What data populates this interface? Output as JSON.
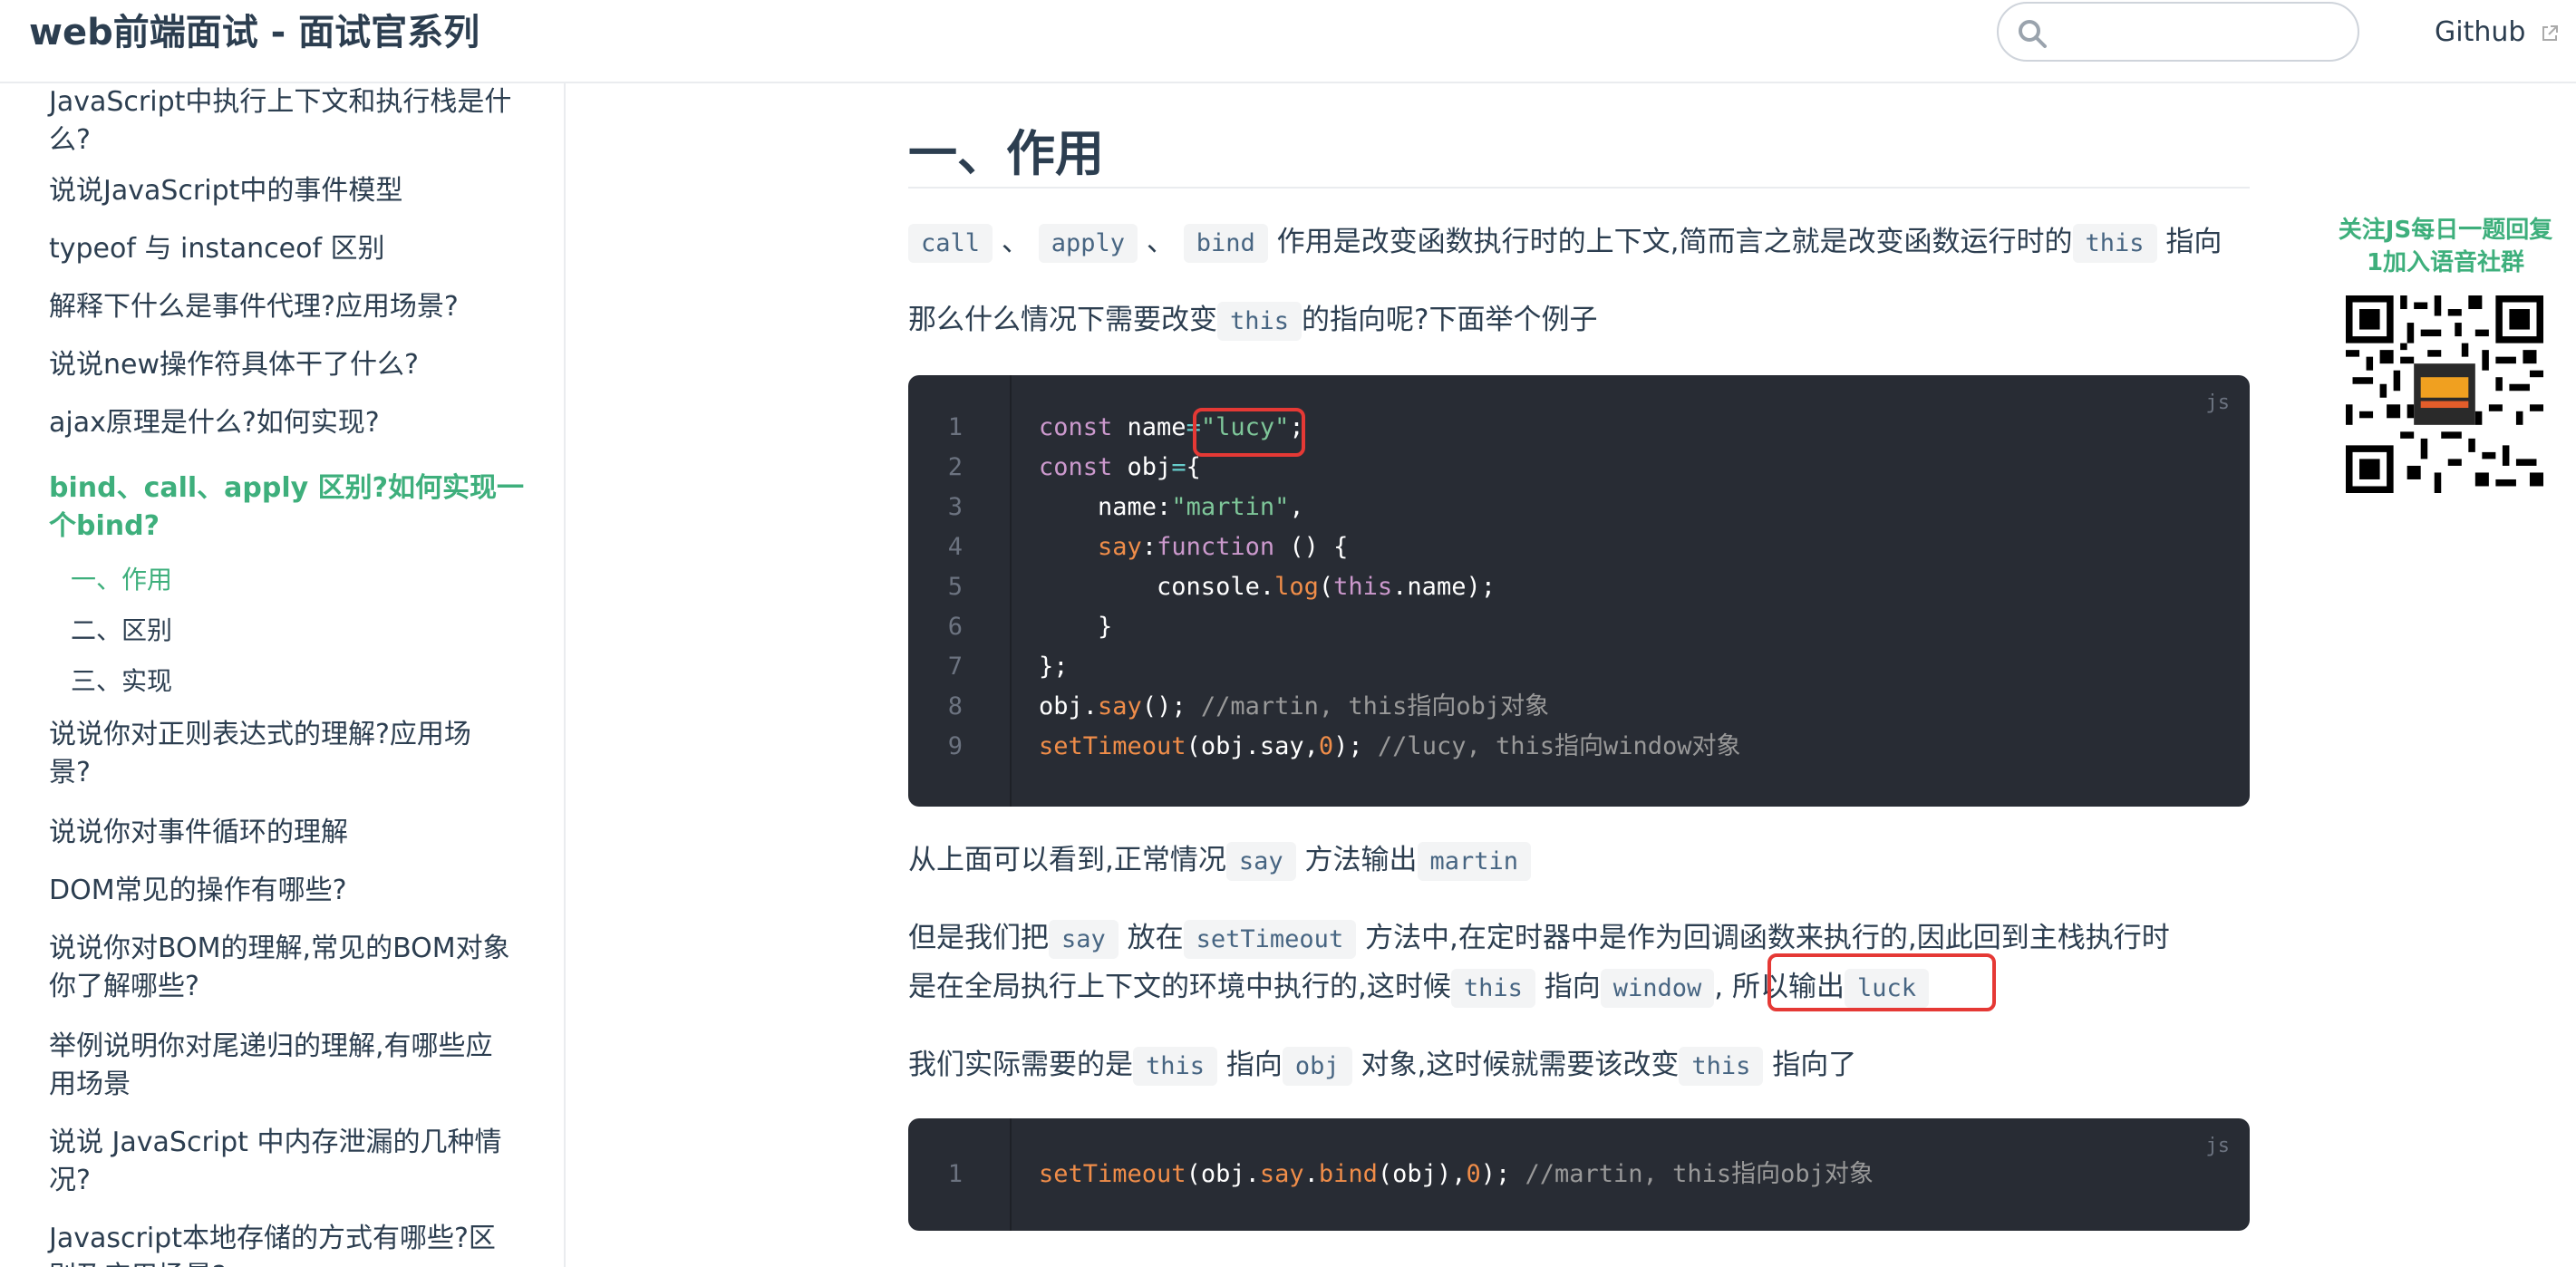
{
  "header": {
    "site_title": "web前端面试 - 面试官系列",
    "search_value": "",
    "github_label": "Github"
  },
  "sidebar": {
    "items": [
      {
        "label_lines": [
          "JavaScript中执行上下文和执行栈是什",
          "么?"
        ],
        "active": false
      },
      {
        "label_lines": [
          "说说JavaScript中的事件模型"
        ],
        "active": false
      },
      {
        "label_lines": [
          "typeof 与 instanceof 区别"
        ],
        "active": false
      },
      {
        "label_lines": [
          "解释下什么是事件代理?应用场景?"
        ],
        "active": false
      },
      {
        "label_lines": [
          "说说new操作符具体干了什么?"
        ],
        "active": false
      },
      {
        "label_lines": [
          "ajax原理是什么?如何实现?"
        ],
        "active": false
      },
      {
        "label_lines": [
          "bind、call、apply 区别?如何实现一",
          "个bind?"
        ],
        "active": true
      },
      {
        "label_lines": [
          "说说你对正则表达式的理解?应用场",
          "景?"
        ],
        "active": false
      },
      {
        "label_lines": [
          "说说你对事件循环的理解"
        ],
        "active": false
      },
      {
        "label_lines": [
          "DOM常见的操作有哪些?"
        ],
        "active": false
      },
      {
        "label_lines": [
          "说说你对BOM的理解,常见的BOM对象",
          "你了解哪些?"
        ],
        "active": false
      },
      {
        "label_lines": [
          "举例说明你对尾递归的理解,有哪些应",
          "用场景"
        ],
        "active": false
      },
      {
        "label_lines": [
          "说说 JavaScript 中内存泄漏的几种情",
          "况?"
        ],
        "active": false
      },
      {
        "label_lines": [
          "Javascript本地存储的方式有哪些?区",
          "别及应用场景?"
        ],
        "active": false
      }
    ],
    "sub_items": [
      {
        "label": "一、作用",
        "active": true
      },
      {
        "label": "二、区别",
        "active": false
      },
      {
        "label": "三、实现",
        "active": false
      }
    ]
  },
  "content": {
    "heading": "一、作用",
    "p1": {
      "code1": "call",
      "sep1": "、",
      "code2": "apply",
      "sep2": "、",
      "code3": "bind",
      "text1": "作用是改变函数执行时的上下文,简而言之就是改变函数运行时的",
      "code4": "this",
      "text2": "指向"
    },
    "p2": {
      "text1": "那么什么情况下需要改变",
      "code1": "this",
      "text2": "的指向呢?下面举个例子"
    },
    "code1": {
      "lang": "js",
      "line_numbers": [
        "1",
        "2",
        "3",
        "4",
        "5",
        "6",
        "7",
        "8",
        "9"
      ]
    },
    "p3": {
      "text1": "从上面可以看到,正常情况",
      "code1": "say",
      "text2": "方法输出",
      "code2": "martin"
    },
    "p4": {
      "line1_text1": "但是我们把",
      "line1_code1": "say",
      "line1_text2": "放在",
      "line1_code2": "setTimeout",
      "line1_text3": "方法中,在定时器中是作为回调函数来执行的,因此回到主栈执行时",
      "line2_text1": "是在全局执行上下文的环境中执行的,这时候",
      "line2_code1": "this",
      "line2_text2": "指向",
      "line2_code2": "window",
      "line2_text3": ",",
      "line2_text4": "所以输出",
      "line2_code3": "luck"
    },
    "p5": {
      "text1": "我们实际需要的是",
      "code1": "this",
      "text2": "指向",
      "code2": "obj",
      "text3": "对象,这时候就需要该改变",
      "code3": "this",
      "text4": "指向了"
    },
    "code2": {
      "lang": "js",
      "line_numbers": [
        "1"
      ]
    }
  },
  "qr_widget": {
    "line1": "关注JS每日一题回复",
    "line2": "1加入语音社群"
  },
  "colors": {
    "accent": "#3eaf7c",
    "code_bg": "#282c34",
    "highlight": "#e53935"
  }
}
